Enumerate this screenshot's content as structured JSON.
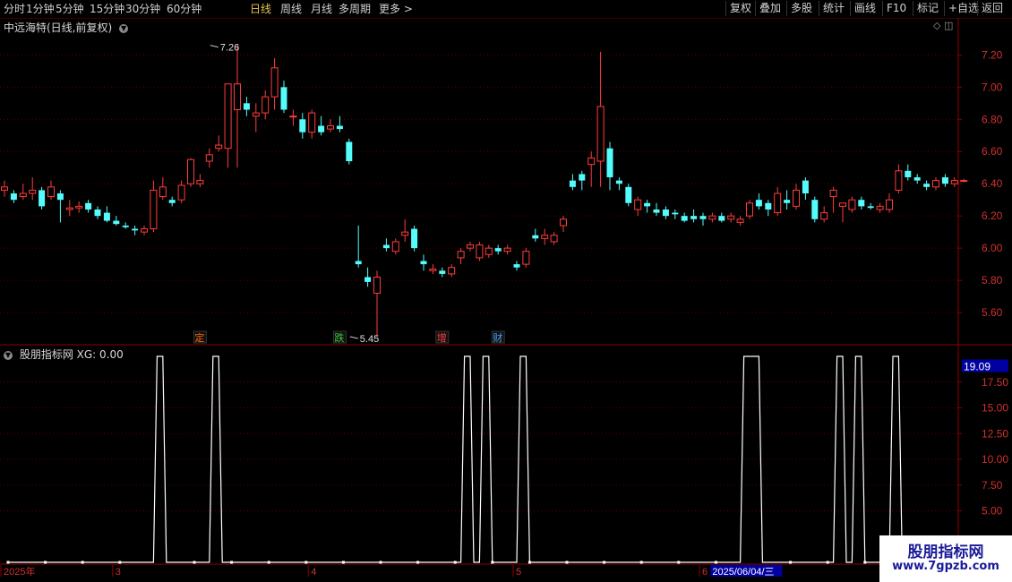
{
  "toolbar": {
    "periods": [
      {
        "label": "分时"
      },
      {
        "label": "1分钟"
      },
      {
        "label": "5分钟"
      },
      {
        "label": "15分钟"
      },
      {
        "label": "30分钟"
      },
      {
        "label": "60分钟"
      },
      {
        "label": "日线",
        "active": true
      },
      {
        "label": "周线"
      },
      {
        "label": "月线"
      },
      {
        "label": "多周期"
      },
      {
        "label": "更多 >"
      }
    ],
    "right_buttons": [
      {
        "label": "复权"
      },
      {
        "label": "叠加"
      },
      {
        "label": "多股"
      },
      {
        "label": "统计"
      },
      {
        "label": "画线"
      },
      {
        "label": "F10"
      },
      {
        "label": "标记"
      },
      {
        "label": "+自选"
      },
      {
        "label": "返回"
      }
    ]
  },
  "header": {
    "stock_title": "中远海特(日线,前复权)"
  },
  "indicator_header": {
    "title": "股朋指标网 XG: 0.00"
  },
  "watermark": {
    "title": "股朋指标网",
    "url": "www.7gpzb.com"
  },
  "colors": {
    "up": "#ff3c3c",
    "down": "#54fcfc",
    "grid": "#5a0000",
    "axis_text": "#d03030",
    "badge": "#0000a0"
  },
  "chart_data": [
    {
      "type": "candlestick",
      "title": "中远海特(日线,前复权)",
      "y_ticks": [
        5.6,
        5.8,
        6.0,
        6.2,
        6.4,
        6.6,
        6.8,
        7.0,
        7.2
      ],
      "ylim": [
        5.4,
        7.33
      ],
      "annotations": [
        {
          "text": "7.26",
          "value": 7.26,
          "bar": 22
        },
        {
          "text": "5.45",
          "value": 5.45,
          "bar": 37
        }
      ],
      "markers": [
        {
          "text": "定",
          "bar": 21,
          "color": "#ff6a00"
        },
        {
          "text": "跌",
          "bar": 36,
          "color": "#3cc83c"
        },
        {
          "text": "增",
          "bar": 47,
          "color": "#ff4040"
        },
        {
          "text": "财",
          "bar": 53,
          "color": "#4aa0ff"
        }
      ],
      "candles": [
        [
          6.36,
          6.42,
          6.32,
          6.38
        ],
        [
          6.34,
          6.36,
          6.28,
          6.3
        ],
        [
          6.32,
          6.4,
          6.3,
          6.34
        ],
        [
          6.34,
          6.44,
          6.3,
          6.36
        ],
        [
          6.36,
          6.38,
          6.24,
          6.26
        ],
        [
          6.32,
          6.42,
          6.3,
          6.38
        ],
        [
          6.34,
          6.36,
          6.16,
          6.3
        ],
        [
          6.24,
          6.3,
          6.2,
          6.25
        ],
        [
          6.25,
          6.29,
          6.22,
          6.26
        ],
        [
          6.28,
          6.3,
          6.22,
          6.24
        ],
        [
          6.24,
          6.26,
          6.18,
          6.2
        ],
        [
          6.22,
          6.26,
          6.16,
          6.17
        ],
        [
          6.17,
          6.2,
          6.14,
          6.15
        ],
        [
          6.14,
          6.16,
          6.12,
          6.13
        ],
        [
          6.12,
          6.14,
          6.08,
          6.11
        ],
        [
          6.1,
          6.14,
          6.08,
          6.12
        ],
        [
          6.12,
          6.42,
          6.1,
          6.36
        ],
        [
          6.32,
          6.44,
          6.3,
          6.38
        ],
        [
          6.3,
          6.32,
          6.26,
          6.28
        ],
        [
          6.3,
          6.42,
          6.28,
          6.39
        ],
        [
          6.4,
          6.56,
          6.38,
          6.55
        ],
        [
          6.4,
          6.46,
          6.38,
          6.42
        ],
        [
          6.54,
          6.62,
          6.5,
          6.58
        ],
        [
          6.62,
          6.7,
          6.6,
          6.64
        ],
        [
          6.62,
          6.84,
          6.5,
          7.02
        ],
        [
          6.86,
          7.26,
          6.5,
          7.02
        ],
        [
          6.9,
          6.94,
          6.82,
          6.86
        ],
        [
          6.82,
          6.9,
          6.72,
          6.84
        ],
        [
          6.84,
          6.98,
          6.8,
          6.94
        ],
        [
          6.94,
          7.18,
          6.86,
          7.12
        ],
        [
          7.0,
          7.04,
          6.84,
          6.86
        ],
        [
          6.82,
          6.86,
          6.76,
          6.82
        ],
        [
          6.8,
          6.84,
          6.68,
          6.72
        ],
        [
          6.72,
          6.86,
          6.68,
          6.84
        ],
        [
          6.76,
          6.82,
          6.7,
          6.72
        ],
        [
          6.74,
          6.8,
          6.72,
          6.76
        ],
        [
          6.76,
          6.82,
          6.72,
          6.74
        ],
        [
          6.66,
          6.68,
          6.52,
          6.54
        ],
        [
          5.92,
          6.14,
          5.88,
          5.9
        ],
        [
          5.82,
          5.88,
          5.76,
          5.79
        ],
        [
          5.72,
          5.86,
          5.45,
          5.82
        ],
        [
          6.02,
          6.06,
          5.98,
          6.0
        ],
        [
          5.98,
          6.06,
          5.96,
          6.04
        ],
        [
          6.08,
          6.18,
          6.04,
          6.1
        ],
        [
          6.12,
          6.14,
          5.98,
          6.0
        ],
        [
          5.92,
          5.96,
          5.86,
          5.9
        ],
        [
          5.86,
          5.9,
          5.84,
          5.87
        ],
        [
          5.86,
          5.88,
          5.82,
          5.84
        ],
        [
          5.84,
          5.9,
          5.82,
          5.88
        ],
        [
          5.94,
          6.0,
          5.9,
          5.98
        ],
        [
          6.0,
          6.04,
          5.98,
          6.02
        ],
        [
          5.94,
          6.04,
          5.92,
          6.02
        ],
        [
          5.96,
          6.02,
          5.94,
          6.0
        ],
        [
          6.0,
          6.02,
          5.96,
          5.98
        ],
        [
          5.98,
          6.02,
          5.96,
          6.0
        ],
        [
          5.9,
          5.92,
          5.86,
          5.88
        ],
        [
          5.9,
          6.0,
          5.88,
          5.98
        ],
        [
          6.08,
          6.12,
          6.04,
          6.06
        ],
        [
          6.06,
          6.12,
          6.02,
          6.08
        ],
        [
          6.04,
          6.1,
          6.02,
          6.08
        ],
        [
          6.14,
          6.2,
          6.1,
          6.18
        ],
        [
          6.42,
          6.46,
          6.36,
          6.38
        ],
        [
          6.46,
          6.48,
          6.36,
          6.42
        ],
        [
          6.52,
          6.6,
          6.38,
          6.56
        ],
        [
          6.54,
          7.22,
          6.38,
          6.88
        ],
        [
          6.62,
          6.66,
          6.36,
          6.44
        ],
        [
          6.42,
          6.44,
          6.36,
          6.4
        ],
        [
          6.38,
          6.4,
          6.26,
          6.28
        ],
        [
          6.24,
          6.32,
          6.2,
          6.3
        ],
        [
          6.28,
          6.3,
          6.22,
          6.26
        ],
        [
          6.24,
          6.28,
          6.2,
          6.22
        ],
        [
          6.24,
          6.26,
          6.18,
          6.2
        ],
        [
          6.22,
          6.24,
          6.18,
          6.21
        ],
        [
          6.2,
          6.22,
          6.16,
          6.17
        ],
        [
          6.2,
          6.24,
          6.16,
          6.18
        ],
        [
          6.2,
          6.22,
          6.14,
          6.18
        ],
        [
          6.18,
          6.22,
          6.16,
          6.2
        ],
        [
          6.2,
          6.22,
          6.16,
          6.17
        ],
        [
          6.18,
          6.22,
          6.16,
          6.2
        ],
        [
          6.16,
          6.2,
          6.14,
          6.18
        ],
        [
          6.2,
          6.3,
          6.18,
          6.28
        ],
        [
          6.3,
          6.34,
          6.24,
          6.26
        ],
        [
          6.28,
          6.3,
          6.2,
          6.24
        ],
        [
          6.22,
          6.38,
          6.2,
          6.34
        ],
        [
          6.3,
          6.36,
          6.24,
          6.28
        ],
        [
          6.26,
          6.4,
          6.24,
          6.36
        ],
        [
          6.42,
          6.44,
          6.3,
          6.34
        ],
        [
          6.3,
          6.32,
          6.16,
          6.18
        ],
        [
          6.18,
          6.26,
          6.16,
          6.22
        ],
        [
          6.32,
          6.38,
          6.22,
          6.36
        ],
        [
          6.26,
          6.28,
          6.16,
          6.28
        ],
        [
          6.24,
          6.32,
          6.22,
          6.3
        ],
        [
          6.3,
          6.32,
          6.24,
          6.26
        ],
        [
          6.26,
          6.28,
          6.24,
          6.25
        ],
        [
          6.24,
          6.28,
          6.22,
          6.26
        ],
        [
          6.24,
          6.34,
          6.22,
          6.3
        ],
        [
          6.36,
          6.52,
          6.34,
          6.48
        ],
        [
          6.48,
          6.52,
          6.42,
          6.44
        ],
        [
          6.44,
          6.46,
          6.4,
          6.42
        ],
        [
          6.4,
          6.42,
          6.36,
          6.38
        ],
        [
          6.38,
          6.44,
          6.36,
          6.42
        ],
        [
          6.44,
          6.46,
          6.38,
          6.4
        ],
        [
          6.4,
          6.44,
          6.38,
          6.42
        ],
        [
          6.42,
          6.43,
          6.41,
          6.42
        ]
      ]
    },
    {
      "type": "line",
      "title": "股朋指标网 XG: 0.00",
      "y_ticks": [
        5.0,
        7.5,
        10.0,
        12.5,
        15.0,
        17.5
      ],
      "ylim": [
        0,
        20
      ],
      "current_label": "19.09",
      "series": [
        {
          "peaks": [
            16,
            22,
            49,
            51,
            55,
            79,
            80,
            89,
            91,
            95
          ]
        }
      ],
      "x_labels": [
        {
          "text": "2025年",
          "bar": 0
        },
        {
          "text": "3",
          "bar": 12
        },
        {
          "text": "4",
          "bar": 33
        },
        {
          "text": "5",
          "bar": 55
        },
        {
          "text": "6",
          "bar": 75
        },
        {
          "text": "2025/06/04/三",
          "bar": 76,
          "highlight": true
        },
        {
          "text": "7",
          "bar": 95
        }
      ]
    }
  ]
}
